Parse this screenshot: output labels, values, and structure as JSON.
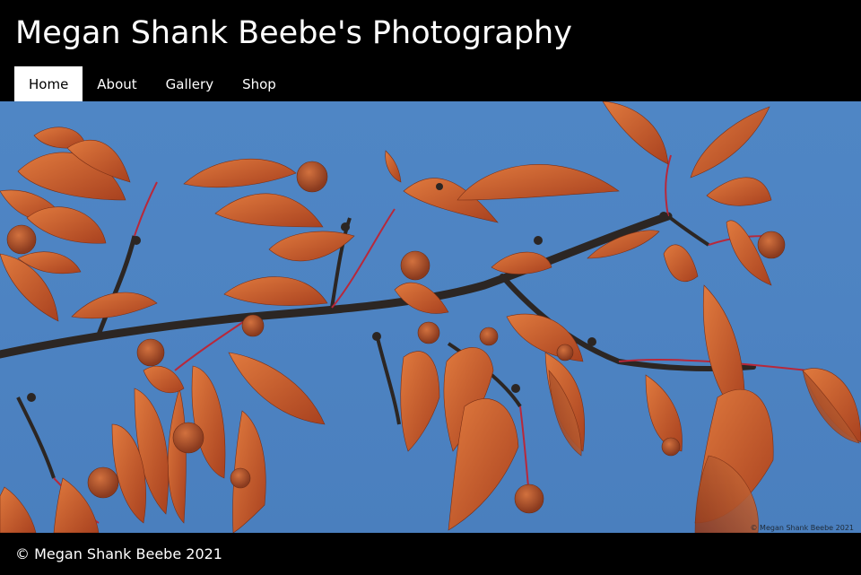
{
  "site": {
    "title": "Megan Shank Beebe's Photography"
  },
  "nav": {
    "items": [
      {
        "label": "Home",
        "active": true
      },
      {
        "label": "About",
        "active": false
      },
      {
        "label": "Gallery",
        "active": false
      },
      {
        "label": "Shop",
        "active": false
      }
    ]
  },
  "hero": {
    "watermark": "© Megan Shank Beebe 2021",
    "colors": {
      "sky": "#4d83c2",
      "leaf": "#c8542a",
      "branch": "#2c2623"
    }
  },
  "footer": {
    "copyright": "© Megan Shank Beebe 2021"
  }
}
